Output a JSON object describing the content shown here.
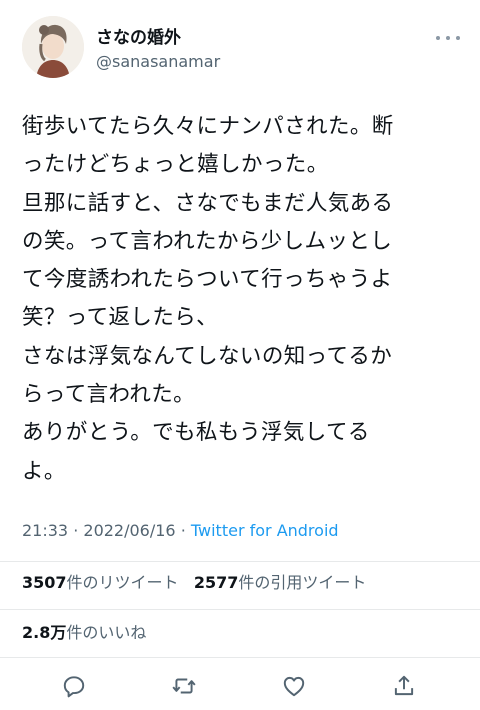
{
  "user": {
    "display_name": "さなの婚外",
    "handle": "@sanasanamar"
  },
  "tweet": {
    "lines": [
      "街歩いてたら久々にナンパされた。断",
      "ったけどちょっと嬉しかった。",
      "旦那に話すと、さなでもまだ人気ある",
      "の笑。って言われたから少しムッとし",
      "て今度誘われたらついて行っちゃうよ",
      "笑？って返したら、",
      "さなは浮気なんてしないの知ってるか",
      "らって言われた。",
      "ありがとう。でも私もう浮気してる",
      "よ。"
    ],
    "time": "21:33",
    "date": "2022/06/16",
    "separator": "·",
    "source": "Twitter for Android"
  },
  "stats": {
    "retweets_count": "3507",
    "retweets_label": "件のリツイート",
    "quotes_count": "2577",
    "quotes_label": "件の引用ツイート",
    "likes_count": "2.8",
    "likes_unit": "万",
    "likes_label": "件のいいね"
  },
  "icons": [
    "more-icon",
    "reply-icon",
    "retweet-icon",
    "like-icon",
    "share-icon"
  ],
  "colors": {
    "link": "#1d9bf0",
    "secondary_text": "#536471",
    "primary_text": "#0f1419",
    "icon": "#536471"
  }
}
